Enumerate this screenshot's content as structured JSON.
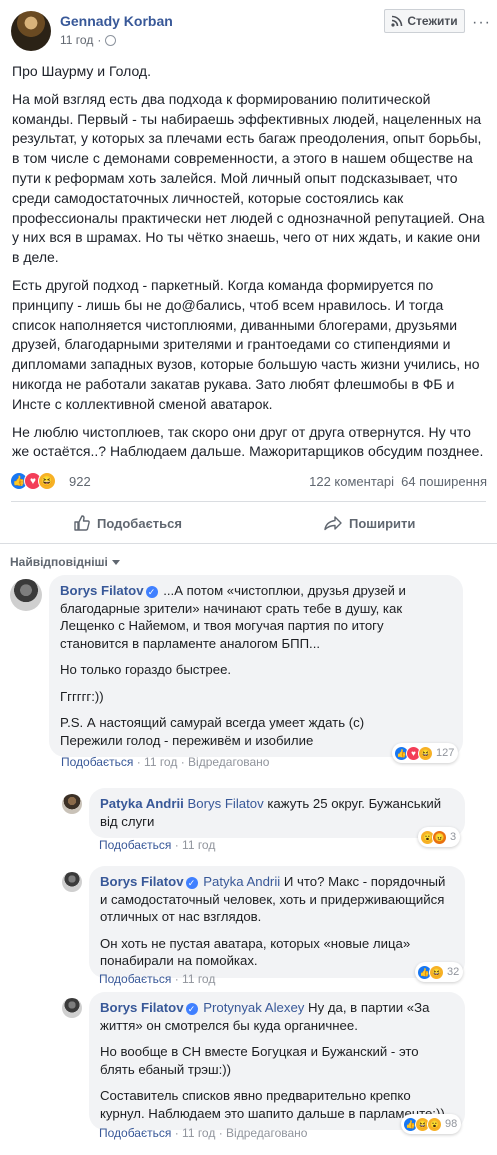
{
  "post": {
    "author": "Gennady Korban",
    "time": "11 год",
    "follow_label": "Стежити",
    "paragraphs": [
      "Про Шаурму и Голод.",
      "На мой взгляд есть два подхода к формированию политической команды. Первый - ты набираешь эффективных людей, нацеленных на результат, у которых за плечами есть багаж преодоления, опыт борьбы, в том числе с демонами современности, а этого в нашем обществе на пути к реформам хоть залейся. Мой личный опыт подсказывает, что среди самодостаточных личностей, которые состоялись как профессионалы практически нет людей с однозначной репутацией. Она у них вся в шрамах. Но ты чётко знаешь, чего от них ждать, и какие они в деле.",
      "Есть другой подход - паркетный. Когда команда формируется по принципу - лишь бы не до@бались, чтоб всем нравилось. И тогда список наполняется чистоплюями, диванными блогерами, друзьями друзей, благодарными зрителями и грантоедами со стипендиями и дипломами западных вузов, которые большую часть жизни учились, но никогда не работали закатав рукава. Зато любят флешмобы в ФБ и Инсте с коллективной сменой аватарок.",
      "Не люблю чистоплюев, так скоро они друг от друга отвернутся. Ну что же остаётся..? Наблюдаем дальше. Мажоритарщиков обсудим позднее."
    ],
    "reactions_count": "922",
    "comments_count": "122 коментарі",
    "shares_count": "64 поширення",
    "like_label": "Подобається",
    "share_label": "Поширити"
  },
  "comments_sort": "Найвідповідніші",
  "comments": [
    {
      "author": "Borys Filatov",
      "mention": "",
      "paragraphs": [
        "...А потом «чистоплюи, друзья друзей и благодарные зрители» начинают срать тебе в душу, как Лещенко с Найемом, и твоя могучая партия по итогу становится в парламенте аналогом БПП...",
        "Но только гораздо быстрее.",
        "Гггггг:))",
        "P.S. А настоящий самурай всегда умеет ждать (с)\nПережили голод - переживём и изобилие"
      ],
      "like": "Подобається",
      "time": "11 год",
      "edited": "Відредаговано",
      "react_count": "127"
    },
    {
      "author": "Patyka Andrii",
      "mention": "Borys Filatov",
      "paragraphs": [
        "кажуть 25 округ. Бужанський від слуги"
      ],
      "like": "Подобається",
      "time": "11 год",
      "edited": "",
      "react_count": "3"
    },
    {
      "author": "Borys Filatov",
      "mention": "Patyka Andrii",
      "paragraphs": [
        "И что? Макс - порядочный и самодостаточный человек, хоть и придерживающийся отличных от нас взглядов.",
        "Он хоть не пустая аватара, которых «новые лица» понабирали на помойках."
      ],
      "like": "Подобається",
      "time": "11 год",
      "edited": "",
      "react_count": "32"
    },
    {
      "author": "Borys Filatov",
      "mention": "Protynyak Alexey",
      "paragraphs": [
        "Ну да, в партии «За життя» он смотрелся бы куда органичнее.",
        "Но вообще в СН вместе Богуцкая и Бужанский - это блять ебаный трэш:))",
        "Составитель списков явно предварительно крепко курнул. Наблюдаем это шапито дальше в парламенте:))"
      ],
      "like": "Подобається",
      "time": "11 год",
      "edited": "Відредаговано",
      "react_count": "98"
    }
  ],
  "colors": {
    "link": "#385898",
    "like": "#1877f2",
    "love": "#f33e58",
    "haha": "#f7b125",
    "bubble": "#f2f3f5"
  }
}
